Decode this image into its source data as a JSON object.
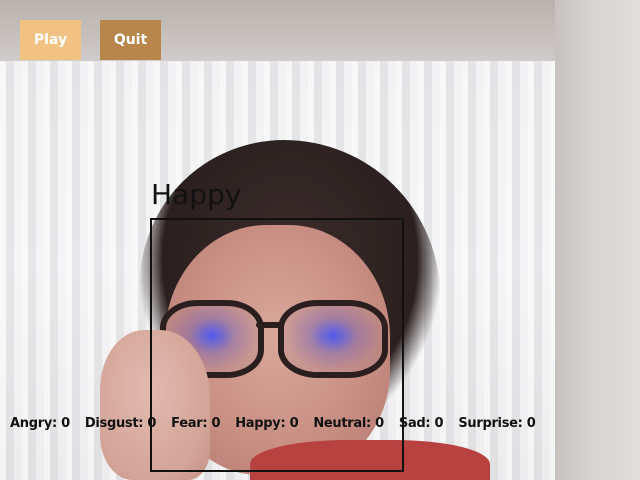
{
  "toolbar": {
    "play_label": "Play",
    "quit_label": "Quit",
    "play_color": "#f1c282",
    "quit_color": "#b8864a"
  },
  "detection": {
    "emotion_label": "Happy",
    "box_color": "#111111"
  },
  "emotion_counts": [
    {
      "label": "Angry: 0"
    },
    {
      "label": "Disgust: 0"
    },
    {
      "label": "Fear: 0"
    },
    {
      "label": "Happy: 0"
    },
    {
      "label": "Neutral: 0"
    },
    {
      "label": "Sad: 0"
    },
    {
      "label": "Surprise: 0"
    }
  ]
}
